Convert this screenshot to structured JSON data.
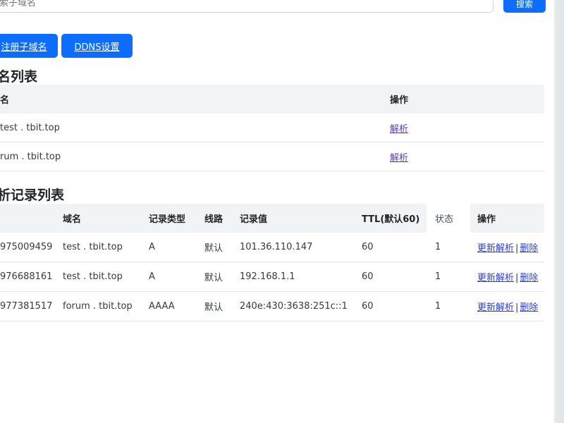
{
  "search": {
    "placeholder": "索子域名",
    "button_label": "搜索"
  },
  "toolbar": {
    "register_label": "注册子域名",
    "ddns_label": "DDNS设置"
  },
  "domain_list": {
    "title": "名列表",
    "headers": [
      "名",
      "操作"
    ],
    "rows": [
      {
        "domain": "test . tbit.top",
        "action": "解析"
      },
      {
        "domain": "rum . tbit.top",
        "action": "解析"
      }
    ]
  },
  "records": {
    "title": "析记录列表",
    "headers": [
      "",
      "域名",
      "记录类型",
      "线路",
      "记录值",
      "TTL(默认60)",
      "状态",
      "操作"
    ],
    "rows": [
      {
        "id": "975009459",
        "domain": "test . tbit.top",
        "type": "A",
        "line": "默认",
        "value": "101.36.110.147",
        "ttl": "60",
        "status": "1",
        "update": "更新解析",
        "delete": "删除"
      },
      {
        "id": "976688161",
        "domain": "test . tbit.top",
        "type": "A",
        "line": "默认",
        "value": "192.168.1.1",
        "ttl": "60",
        "status": "1",
        "update": "更新解析",
        "delete": "删除"
      },
      {
        "id": "977381517",
        "domain": "forum . tbit.top",
        "type": "AAAA",
        "line": "默认",
        "value": "240e:430:3638:251c::1",
        "ttl": "60",
        "status": "1",
        "update": "更新解析",
        "delete": "删除"
      }
    ],
    "separator": "|"
  },
  "colors": {
    "primary": "#0d6efd",
    "header_bg": "#f1f3f5",
    "link_visited": "#5b3fa6",
    "link": "#2c3ed6"
  }
}
